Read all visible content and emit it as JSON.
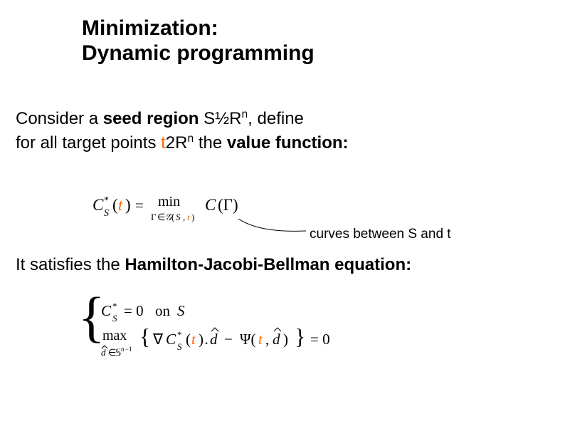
{
  "title": {
    "line1": "Minimization:",
    "line2": "Dynamic programming"
  },
  "paragraph1": {
    "pre": "Consider a ",
    "seed_region": "seed region",
    "s_part": " S½R",
    "sup1": "n",
    "define": ", define",
    "line2_pre": "for all target points ",
    "t_part": "t",
    "t_rest": "2R",
    "sup2": "n",
    "line2_post": " the ",
    "value_fn": "value function:"
  },
  "annotation": "curves between S and t",
  "paragraph2": {
    "pre": "It satisfies the ",
    "bold": "Hamilton-Jacobi-Bellman equation:"
  },
  "equations": {
    "eq1_label": "value-function-definition",
    "eq2_label": "hamilton-jacobi-bellman"
  },
  "colors": {
    "orange": "#ff6600"
  }
}
